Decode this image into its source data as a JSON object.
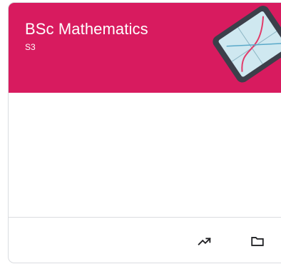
{
  "course": {
    "title": "BSc Mathematics",
    "section": "S3",
    "banner_color": "#d81b5f"
  },
  "footer": {
    "insights_icon": "trending-up-icon",
    "folder_icon": "folder-icon"
  }
}
